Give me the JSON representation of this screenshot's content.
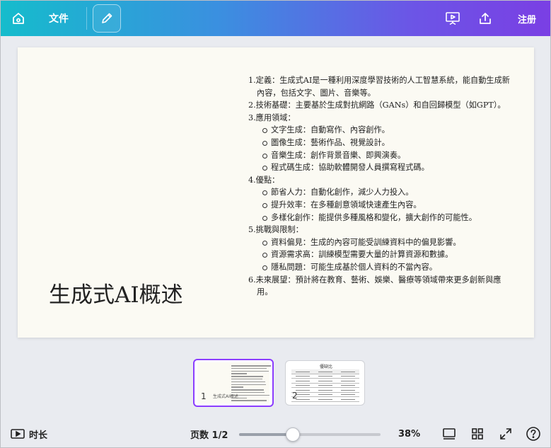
{
  "topbar": {
    "file_label": "文件",
    "register_label": "注册",
    "icons": [
      "home-icon",
      "pencil-icon",
      "present-icon",
      "share-icon"
    ]
  },
  "slide": {
    "title": "生成式AI概述",
    "body": [
      {
        "type": "p",
        "text": "1.定義：生成式AI是一種利用深度學習技術的人工智慧系統，能自動生成新內容，包括文字、圖片、音樂等。"
      },
      {
        "type": "p",
        "text": "2.技術基礎：主要基於生成對抗網路（GANs）和自回歸模型（如GPT）。"
      },
      {
        "type": "p",
        "text": "3.應用領域："
      },
      {
        "type": "sub",
        "text": "文字生成：自動寫作、內容創作。"
      },
      {
        "type": "sub",
        "text": "圖像生成：藝術作品、視覺設計。"
      },
      {
        "type": "sub",
        "text": "音樂生成：創作背景音樂、即興演奏。"
      },
      {
        "type": "sub",
        "text": "程式碼生成：協助軟體開發人員撰寫程式碼。"
      },
      {
        "type": "p",
        "text": "4.優點："
      },
      {
        "type": "sub",
        "text": "節省人力：自動化創作，減少人力投入。"
      },
      {
        "type": "sub",
        "text": "提升效率：在多種創意領域快速產生內容。"
      },
      {
        "type": "sub",
        "text": "多樣化創作：能提供多種風格和變化，擴大創作的可能性。"
      },
      {
        "type": "p",
        "text": "5.挑戰與限制："
      },
      {
        "type": "sub",
        "text": "資料偏見：生成的內容可能受訓練資料中的偏見影響。"
      },
      {
        "type": "sub",
        "text": "資源需求高：訓練模型需要大量的計算資源和數據。"
      },
      {
        "type": "sub",
        "text": "隱私問題：可能生成基於個人資料的不當內容。"
      },
      {
        "type": "p",
        "text": "6.未來展望：預計將在教育、藝術、娛樂、醫療等領域帶來更多創新與應用。"
      }
    ]
  },
  "thumbnails": [
    {
      "number": "1",
      "caption": "生成式AI概述",
      "selected": true
    },
    {
      "number": "2",
      "caption": "優缺比",
      "selected": false
    }
  ],
  "bottombar": {
    "duration_label": "时长",
    "page_label": "页数 1/2",
    "zoom_label": "38%",
    "zoom_fraction": 0.38,
    "icons": [
      "present-view-icon",
      "grid-view-icon",
      "fullscreen-icon",
      "help-icon"
    ]
  }
}
